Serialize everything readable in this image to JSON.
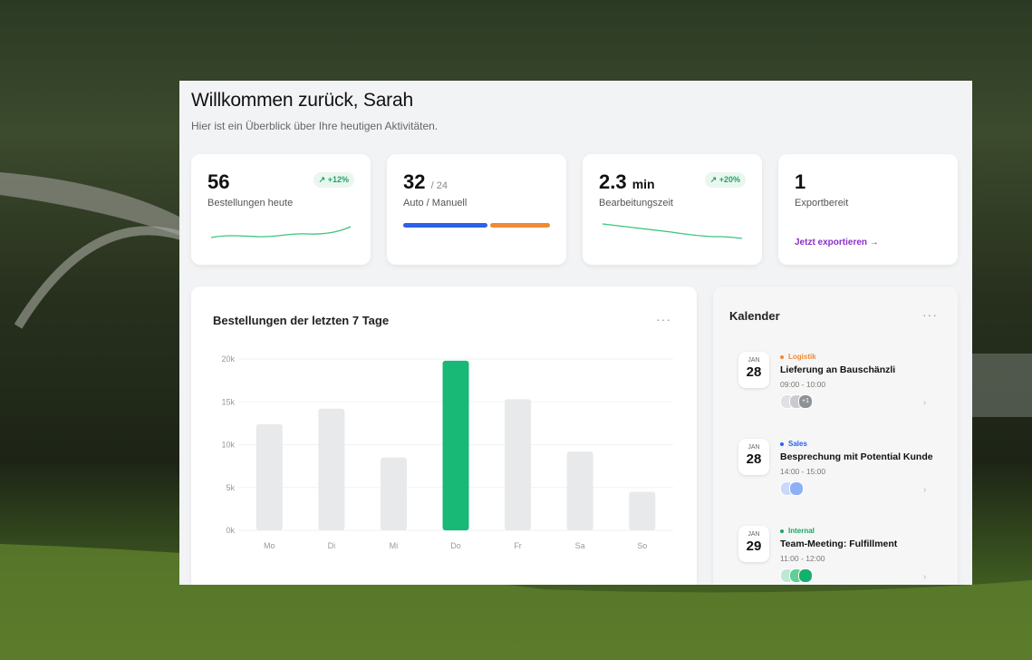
{
  "header": {
    "title": "Willkommen zurück, Sarah",
    "subtitle": "Hier ist ein Überblick über Ihre heutigen Aktivitäten."
  },
  "stats": [
    {
      "value": "56",
      "label": "Bestellungen heute",
      "trend": "+12%"
    },
    {
      "value": "32",
      "sub": "/ 24",
      "label": "Auto / Manuell"
    },
    {
      "value": "2.3",
      "unit": "min",
      "label": "Bearbeitungszeit",
      "trend": "+20%"
    },
    {
      "value": "1",
      "label": "Exportbereit",
      "link": "Jetzt exportieren →"
    }
  ],
  "colors": {
    "accent_green": "#1fa463",
    "bar_highlight": "#18b877",
    "bar_default": "#e7e9eb",
    "blue": "#2b62e8",
    "orange": "#f08a34",
    "purple": "#8b2fc9"
  },
  "chart": {
    "title": "Bestellungen der letzten 7 Tage",
    "menu": "···"
  },
  "chart_data": {
    "type": "bar",
    "categories": [
      "Mo",
      "Di",
      "Mi",
      "Do",
      "Fr",
      "Sa",
      "So"
    ],
    "values": [
      12400,
      14200,
      8500,
      19800,
      15300,
      9200,
      4500
    ],
    "highlight_index": 3,
    "yticks": [
      "0k",
      "5k",
      "10k",
      "15k",
      "20k"
    ],
    "ylim": [
      0,
      20000
    ],
    "title": "Bestellungen der letzten 7 Tage",
    "xlabel": "",
    "ylabel": ""
  },
  "calendar": {
    "title": "Kalender",
    "menu": "···",
    "events": [
      {
        "month": "JAN",
        "day": "28",
        "category": "Logistik",
        "cat_color": "#f08a34",
        "title": "Lieferung an Bauschänzli",
        "time": "09:00 - 10:00",
        "extra": "+1"
      },
      {
        "month": "JAN",
        "day": "28",
        "category": "Sales",
        "cat_color": "#2b62e8",
        "title": "Besprechung mit Potential Kunde",
        "time": "14:00 - 15:00"
      },
      {
        "month": "JAN",
        "day": "29",
        "category": "Internal",
        "cat_color": "#1fa463",
        "title": "Team-Meeting: Fulfillment",
        "time": "11:00 - 12:00"
      }
    ]
  }
}
